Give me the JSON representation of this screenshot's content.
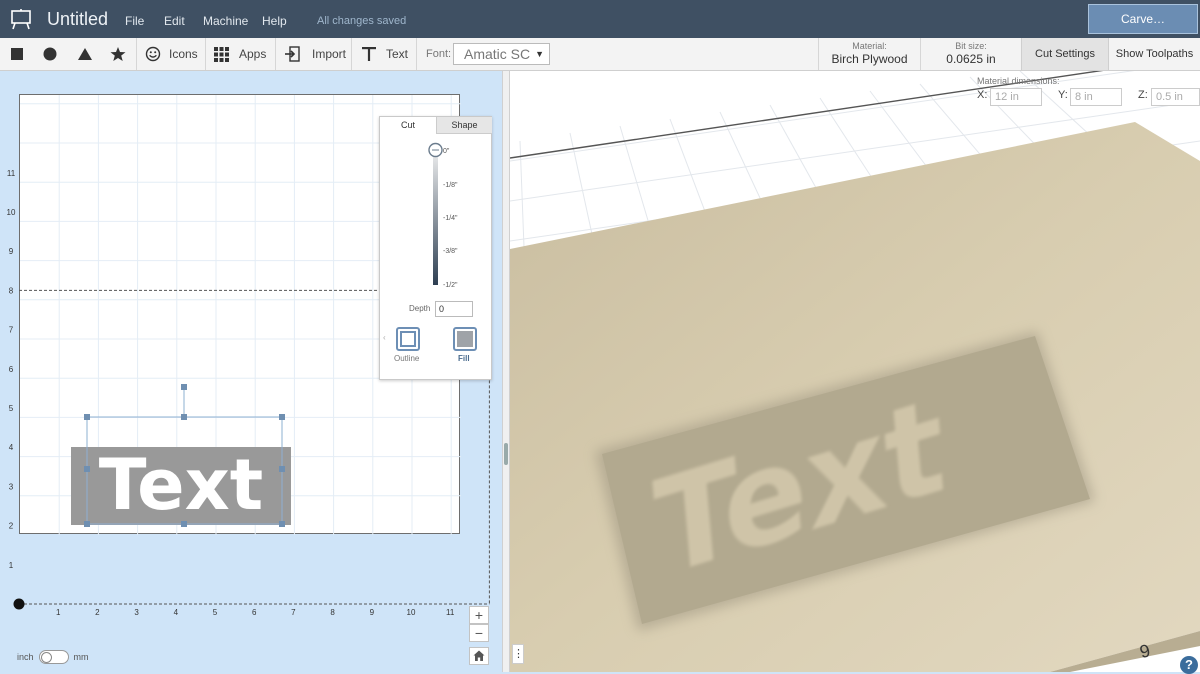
{
  "app": {
    "title": "Untitled",
    "saved_status": "All changes saved",
    "menu": [
      "File",
      "Edit",
      "Machine",
      "Help"
    ],
    "carve_label": "Carve…"
  },
  "toolbar": {
    "shapes": [
      "square-icon",
      "circle-icon",
      "triangle-icon",
      "star-icon"
    ],
    "icons_label": "Icons",
    "apps_label": "Apps",
    "import_label": "Import",
    "text_label": "Text",
    "font_label": "Font:",
    "font_value": "Amatic SC",
    "material_label": "Material:",
    "material_value": "Birch Plywood",
    "bitsize_label": "Bit size:",
    "bitsize_value": "0.0625 in",
    "cut_settings_label": "Cut Settings",
    "show_toolpaths_label": "Show Toolpaths"
  },
  "material_dimensions": {
    "label": "Material dimensions:",
    "x_label": "X:",
    "x_value": "12 in",
    "y_label": "Y:",
    "y_value": "8 in",
    "z_label": "Z:",
    "z_value": "0.5 in"
  },
  "canvas": {
    "x_ticks": [
      "1",
      "2",
      "3",
      "4",
      "5",
      "6",
      "7",
      "8",
      "9",
      "10",
      "11"
    ],
    "y_ticks": [
      "11",
      "10",
      "9",
      "8",
      "7",
      "6",
      "5",
      "4",
      "3",
      "2",
      "1"
    ],
    "design_text": "Text"
  },
  "cut_panel": {
    "tabs": [
      "Cut",
      "Shape"
    ],
    "depth_ticks": [
      "0\"",
      "-1/8\"",
      "-1/4\"",
      "-3/8\"",
      "-1/2\""
    ],
    "depth_label": "Depth",
    "depth_value": "0",
    "outline_label": "Outline",
    "fill_label": "Fill"
  },
  "zoom": {
    "in": "+",
    "out": "−"
  },
  "units": {
    "left": "inch",
    "right": "mm"
  },
  "preview": {
    "corner_label": "9"
  },
  "help_label": "?"
}
